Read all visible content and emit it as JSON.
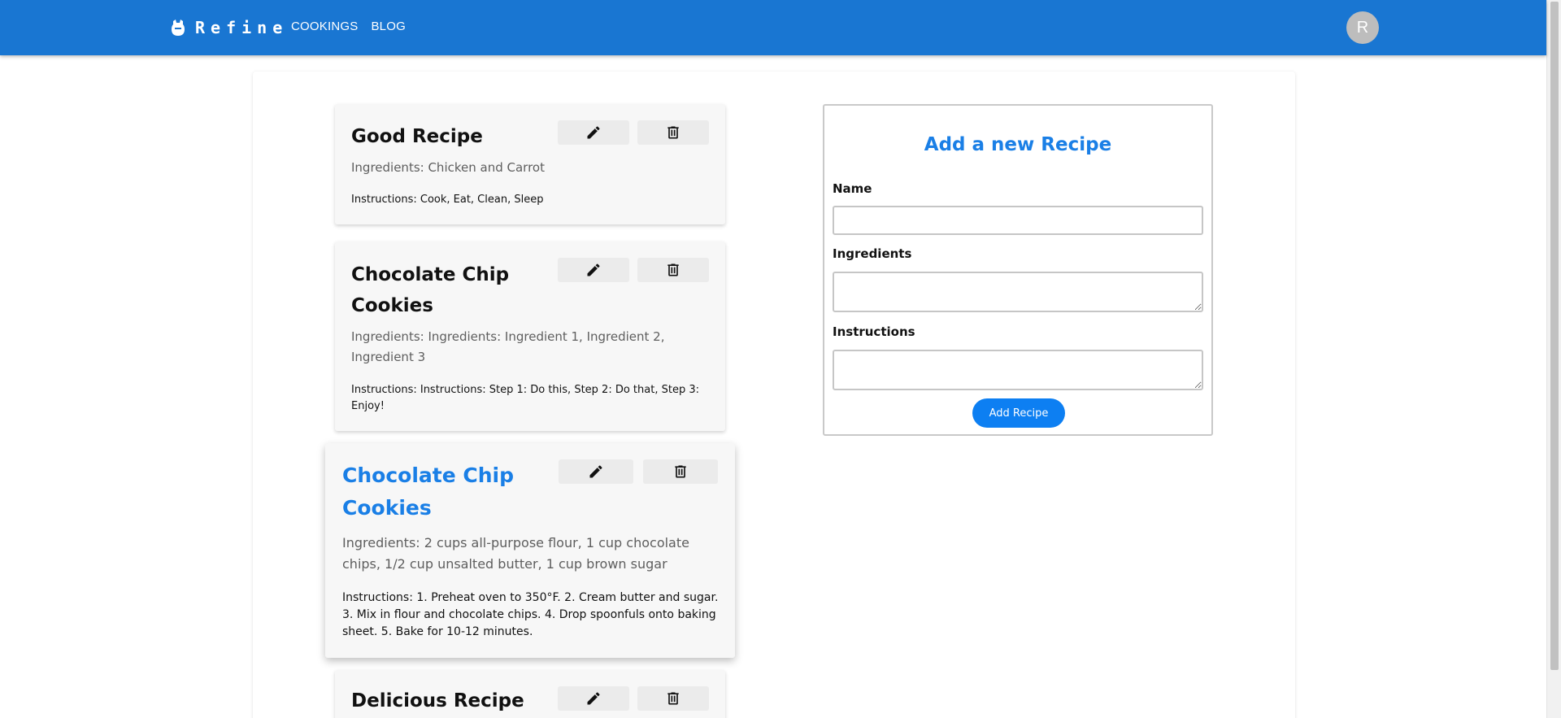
{
  "header": {
    "brand": "Refine",
    "nav": [
      "COOKINGS",
      "BLOG"
    ],
    "avatar_initial": "R",
    "brand_color": "#1976d2"
  },
  "recipes": [
    {
      "title": "Good Recipe",
      "ingredients": "Ingredients: Chicken and Carrot",
      "instructions": "Instructions: Cook, Eat, Clean, Sleep"
    },
    {
      "title": "Chocolate Chip Cookies",
      "ingredients": "Ingredients: Ingredients: Ingredient 1, Ingredient 2, Ingredient 3",
      "instructions": "Instructions: Instructions: Step 1: Do this, Step 2: Do that, Step 3: Enjoy!"
    },
    {
      "title": "Chocolate Chip Cookies",
      "ingredients": "Ingredients: 2 cups all-purpose flour, 1 cup chocolate chips, 1/2 cup unsalted butter, 1 cup brown sugar",
      "instructions": "Instructions: 1. Preheat oven to 350°F. 2. Cream butter and sugar. 3. Mix in flour and chocolate chips. 4. Drop spoonfuls onto baking sheet. 5. Bake for 10-12 minutes."
    },
    {
      "title": "Delicious Recipe",
      "ingredients": "",
      "instructions": ""
    }
  ],
  "form": {
    "title": "Add a new Recipe",
    "name_label": "Name",
    "name_value": "",
    "ingredients_label": "Ingredients",
    "ingredients_value": "",
    "instructions_label": "Instructions",
    "instructions_value": "",
    "submit_label": "Add Recipe",
    "accent_color": "#1a7fe6"
  },
  "icons": {
    "edit": "pencil-icon",
    "delete": "trash-icon"
  }
}
